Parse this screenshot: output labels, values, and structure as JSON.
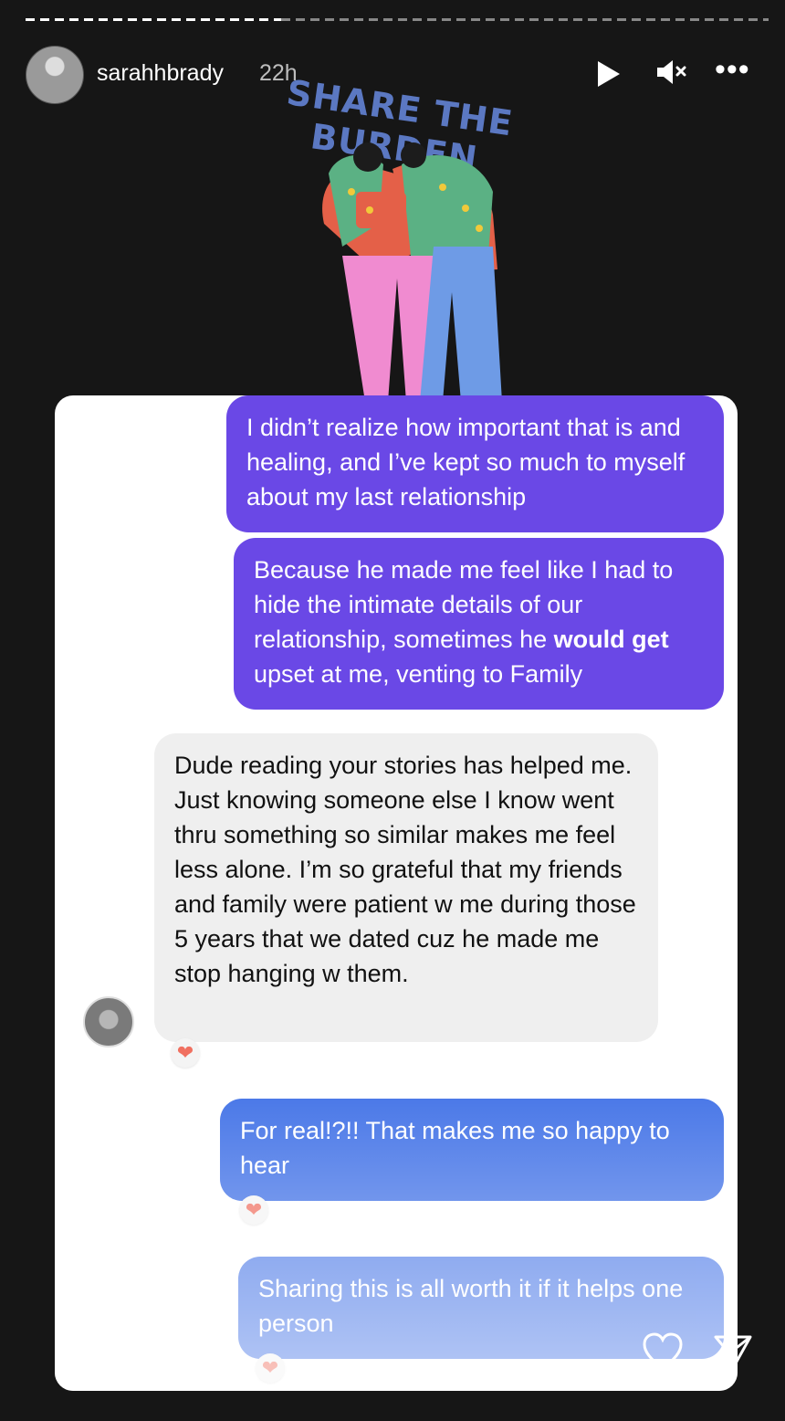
{
  "story": {
    "username": "sarahhbrady",
    "time": "22h",
    "progress": 0.33
  },
  "sticker": {
    "title": "SHARE THE BURDEN"
  },
  "messages": [
    {
      "from": "me",
      "text": "I didn’t realize how important that is and healing, and I’ve kept so much to myself about my last relationship"
    },
    {
      "from": "me",
      "text_prefix": "Because he made me feel like I had to hide the intimate details of our relationship, sometimes he ",
      "text_strong": "would get",
      "text_suffix": " upset at me, venting to Family"
    },
    {
      "from": "friend",
      "text": "Dude reading your stories has helped me. Just knowing someone else I know went thru something so similar makes me feel less alone. I’m so grateful that my friends and family were patient w me during those 5 years that we dated cuz he made me stop hanging w them."
    },
    {
      "from": "me",
      "text": "For real!?!! That makes me so happy to hear"
    },
    {
      "from": "me",
      "text": "Sharing this is all worth it if it helps one person"
    }
  ],
  "reactions": {
    "heart": "❤"
  },
  "footer": {
    "like_icon": "heart-icon",
    "share_icon": "send-icon"
  },
  "colors": {
    "purple": "#6a48e6",
    "blue": "#3e6fe6",
    "gray": "#efefef"
  }
}
